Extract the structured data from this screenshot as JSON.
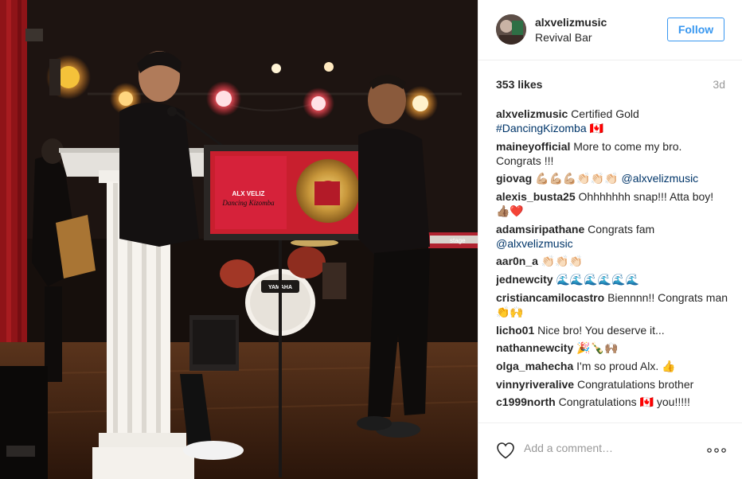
{
  "post": {
    "username": "alxvelizmusic",
    "location": "Revival Bar",
    "follow_label": "Follow",
    "likes": "353 likes",
    "age": "3d"
  },
  "photo": {
    "record_title": "Dancing Kizomba",
    "record_artist": "ALX VELIZ",
    "drum_brand": "YAMAHA",
    "keyboard_brand": "stage"
  },
  "comments": [
    {
      "author": "alxvelizmusic",
      "text": "Certified Gold",
      "tag": "#DancingKizomba",
      "emoji": "🇨🇦"
    },
    {
      "author": "maineyofficial",
      "text": "More to come my bro. Congrats !!!"
    },
    {
      "author": "giovag",
      "emoji": "💪🏼💪🏼💪🏼👏🏻👏🏻👏🏻",
      "tag": "@alxvelizmusic"
    },
    {
      "author": "alexis_busta25",
      "text": "Ohhhhhhh snap!!! Atta boy!",
      "emoji": "👍🏽❤️"
    },
    {
      "author": "adamsiripathane",
      "text": "Congrats fam",
      "tag": "@alxvelizmusic"
    },
    {
      "author": "aar0n_a",
      "emoji": "👏🏻👏🏻👏🏻"
    },
    {
      "author": "jednewcity",
      "emoji": "🌊🌊🌊🌊🌊🌊"
    },
    {
      "author": "cristiancamilocastro",
      "text": "Biennnn!! Congrats man",
      "emoji": "👏🙌"
    },
    {
      "author": "licho01",
      "text": "Nice bro! You deserve it..."
    },
    {
      "author": "nathannewcity",
      "emoji": "🎉🍾🙌🏽"
    },
    {
      "author": "olga_mahecha",
      "text": "I'm so proud Alx.",
      "emoji": "👍"
    },
    {
      "author": "vinnyriveralive",
      "text": "Congratulations brother"
    },
    {
      "author": "c1999north",
      "text": "Congratulations",
      "emoji": "🇨🇦",
      "extra": "you!!!!!"
    }
  ],
  "footer": {
    "placeholder": "Add a comment…",
    "more_label": "ooo"
  },
  "colors": {
    "accent": "#3897f0",
    "tag": "#003569",
    "muted": "#999999",
    "border": "#efefef"
  }
}
